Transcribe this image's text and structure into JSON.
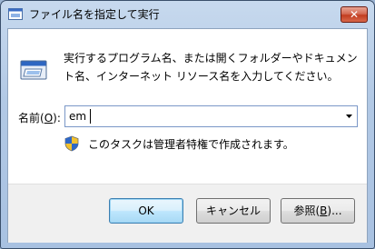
{
  "window": {
    "title": "ファイル名を指定して実行",
    "close_label": "✕"
  },
  "dialog": {
    "description": "実行するプログラム名、または開くフォルダーやドキュメント名、インターネット リソース名を入力してください。",
    "name_label_prefix": "名前(",
    "name_label_access_key": "O",
    "name_label_suffix": "):",
    "combo_value": "em",
    "admin_note": "このタスクは管理者特権で作成されます。"
  },
  "buttons": {
    "ok": "OK",
    "cancel": "キャンセル",
    "browse_prefix": "参照(",
    "browse_access_key": "B",
    "browse_suffix": ")..."
  },
  "icons": {
    "app": "run-dialog-icon",
    "run": "run-program-icon",
    "shield": "uac-shield-icon",
    "dropdown": "chevron-down-icon",
    "close": "close-icon"
  }
}
